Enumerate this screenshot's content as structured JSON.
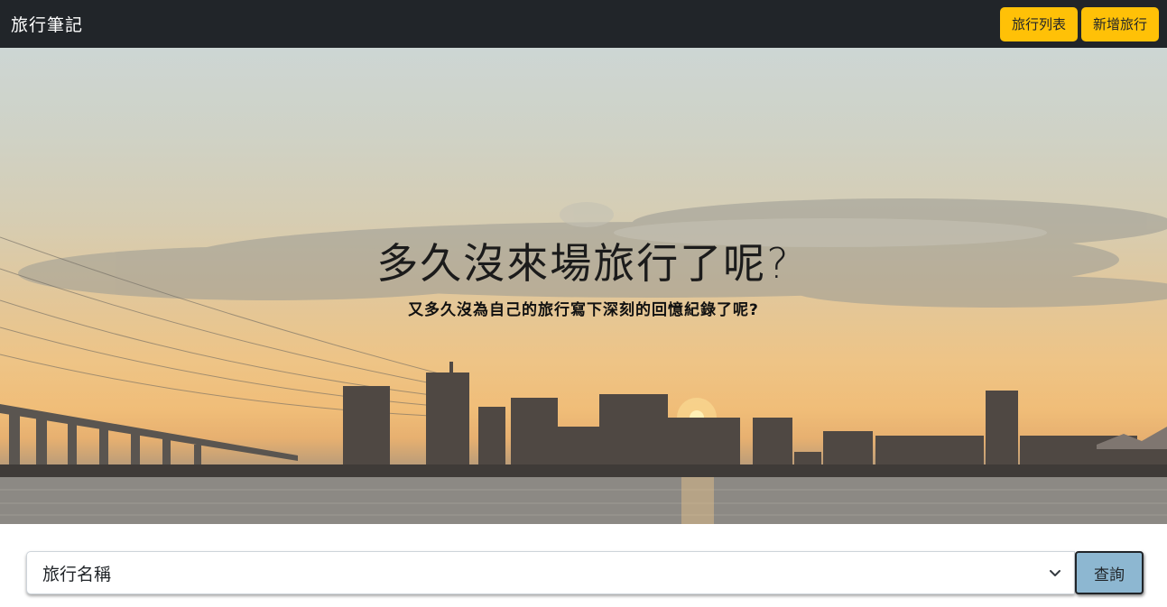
{
  "navbar": {
    "brand": "旅行筆記",
    "trip_list_label": "旅行列表",
    "add_trip_label": "新增旅行",
    "button_color": "#ffc107",
    "background_color": "#212529"
  },
  "hero": {
    "title": "多久沒來場旅行了呢?",
    "subtitle": "又多久沒為自己的旅行寫下深刻的回憶紀錄了呢?"
  },
  "search": {
    "select_value": "旅行名稱",
    "query_label": "查詢",
    "query_color": "#8db7d1"
  },
  "icons": {
    "select_arrow": "chevron-down-icon"
  }
}
